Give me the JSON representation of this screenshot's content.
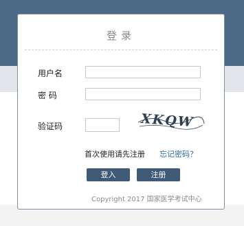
{
  "login": {
    "title": "登录",
    "username_label": "用户名",
    "password_label": "密 码",
    "captcha_label": "验证码",
    "captcha_text": "XKQW",
    "register_link": "首次使用请先注册",
    "forgot_link": "忘记密码？",
    "login_button": "登入",
    "register_button": "注册",
    "copyright": "Copyright 2017 国家医学考试中心"
  },
  "colors": {
    "header_bg": "#4d6a88",
    "button_bg": "#3e5a77",
    "link_blue": "#2a6aa0"
  }
}
